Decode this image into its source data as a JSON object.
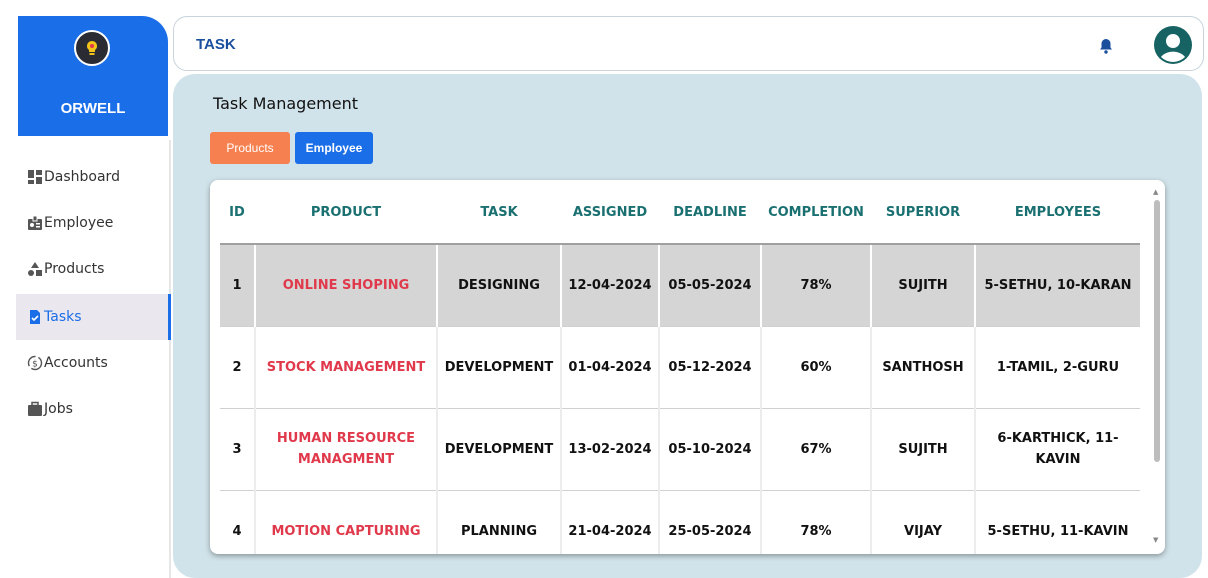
{
  "brand": {
    "name": "ORWELL"
  },
  "sidebar": {
    "items": [
      {
        "label": "Dashboard",
        "icon": "dashboard-icon"
      },
      {
        "label": "Employee",
        "icon": "badge-icon"
      },
      {
        "label": "Products",
        "icon": "shapes-icon"
      },
      {
        "label": "Tasks",
        "icon": "task-file-icon",
        "active": true
      },
      {
        "label": "Accounts",
        "icon": "money-cycle-icon"
      },
      {
        "label": "Jobs",
        "icon": "briefcase-icon"
      }
    ]
  },
  "header": {
    "title": "TASK"
  },
  "main": {
    "title": "Task Management",
    "buttons": {
      "products": "Products",
      "employee": "Employee"
    },
    "table": {
      "columns": [
        "ID",
        "PRODUCT",
        "TASK",
        "ASSIGNED",
        "DEADLINE",
        "COMPLETION",
        "SUPERIOR",
        "EMPLOYEES"
      ],
      "rows": [
        [
          "1",
          "ONLINE SHOPING",
          "DESIGNING",
          "12-04-2024",
          "05-05-2024",
          "78%",
          "SUJITH",
          "5-SETHU, 10-KARAN"
        ],
        [
          "2",
          "STOCK MANAGEMENT",
          "DEVELOPMENT",
          "01-04-2024",
          "05-12-2024",
          "60%",
          "SANTHOSH",
          "1-TAMIL, 2-GURU"
        ],
        [
          "3",
          "HUMAN RESOURCE MANAGMENT",
          "DEVELOPMENT",
          "13-02-2024",
          "05-10-2024",
          "67%",
          "SUJITH",
          "6-KARTHICK, 11-KAVIN"
        ],
        [
          "4",
          "MOTION CAPTURING",
          "PLANNING",
          "21-04-2024",
          "25-05-2024",
          "78%",
          "VIJAY",
          "5-SETHU, 11-KAVIN"
        ]
      ]
    }
  },
  "colors": {
    "accent": "#1a6ee8",
    "products_button": "#f6804f",
    "product_text": "#e0394b",
    "header_text": "#1a7070",
    "panel_bg": "#d1e3ea"
  }
}
